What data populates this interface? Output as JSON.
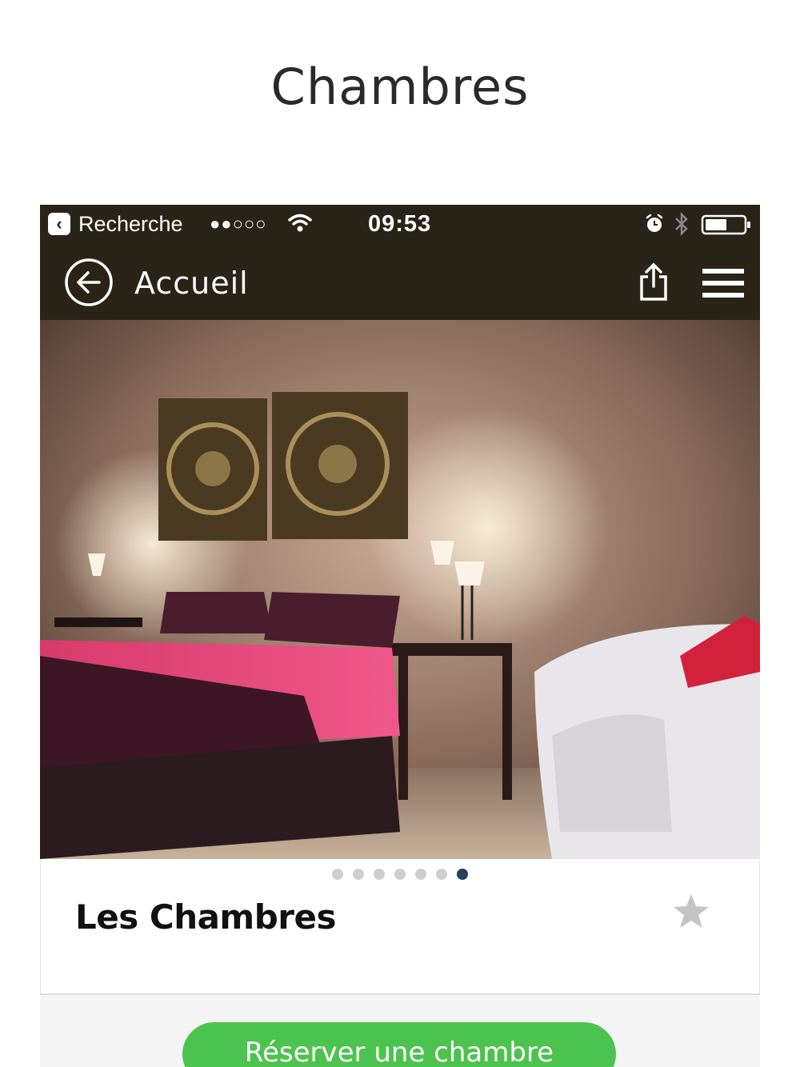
{
  "page": {
    "title": "Chambres"
  },
  "status_bar": {
    "back_app_label": "Recherche",
    "signal": "●●○○○",
    "time": "09:53"
  },
  "nav": {
    "title": "Accueil"
  },
  "carousel": {
    "total_pages": 7,
    "active_page": 7
  },
  "room": {
    "title": "Les Chambres"
  },
  "booking": {
    "button_label": "Réserver une chambre"
  },
  "colors": {
    "nav_bg": "#2a2317",
    "accent_green": "#4cc34e",
    "active_dot": "#2a3f5c"
  },
  "icons": [
    "back-app-icon",
    "wifi-icon",
    "alarm-icon",
    "bluetooth-icon",
    "battery-icon",
    "back-arrow-icon",
    "share-icon",
    "menu-icon",
    "star-icon"
  ]
}
